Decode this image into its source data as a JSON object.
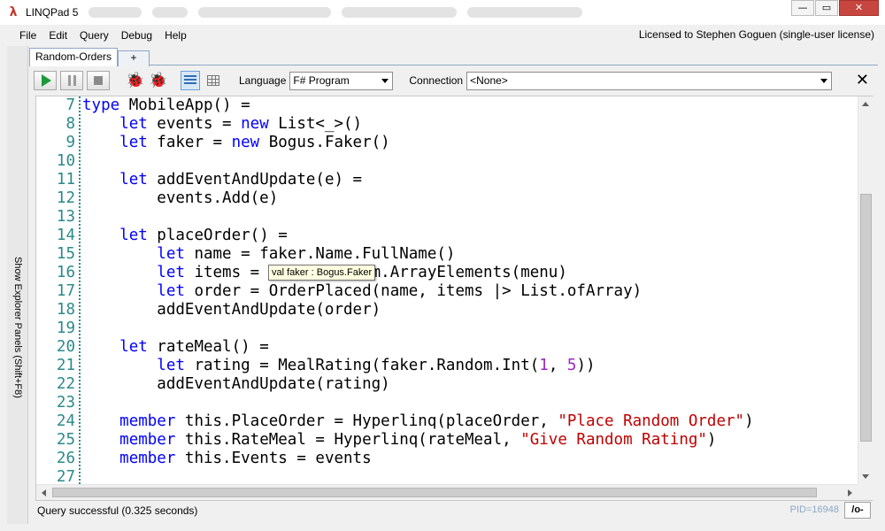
{
  "window": {
    "title": "LINQPad 5",
    "minimize_glyph": "—",
    "maximize_glyph": "▭",
    "close_glyph": "✕"
  },
  "menu": {
    "items": [
      {
        "label": "File"
      },
      {
        "label": "Edit"
      },
      {
        "label": "Query"
      },
      {
        "label": "Debug"
      },
      {
        "label": "Help"
      }
    ],
    "license": "Licensed to Stephen Goguen (single-user license)"
  },
  "side": {
    "explorer_label": "Show Explorer Panels  (Shift+F8)"
  },
  "tabs": {
    "active": "Random-Orders",
    "add": "+"
  },
  "toolbar": {
    "language_label": "Language",
    "language_value": "F# Program",
    "connection_label": "Connection",
    "connection_value": "<None>",
    "close_glyph": "✕"
  },
  "editor": {
    "lines": [
      {
        "n": "7",
        "tokens": [
          {
            "t": "type",
            "k": "kw"
          },
          {
            "t": " MobileApp() ="
          }
        ]
      },
      {
        "n": "8",
        "tokens": [
          {
            "t": "    "
          },
          {
            "t": "let",
            "k": "kw"
          },
          {
            "t": " events = "
          },
          {
            "t": "new",
            "k": "kw"
          },
          {
            "t": " List<_>()"
          }
        ]
      },
      {
        "n": "9",
        "tokens": [
          {
            "t": "    "
          },
          {
            "t": "let",
            "k": "kw"
          },
          {
            "t": " faker = "
          },
          {
            "t": "new",
            "k": "kw"
          },
          {
            "t": " Bogus.Faker()"
          }
        ]
      },
      {
        "n": "10",
        "tokens": []
      },
      {
        "n": "11",
        "tokens": [
          {
            "t": "    "
          },
          {
            "t": "let",
            "k": "kw"
          },
          {
            "t": " addEventAndUpdate(e) ="
          }
        ]
      },
      {
        "n": "12",
        "tokens": [
          {
            "t": "        events.Add(e)"
          }
        ]
      },
      {
        "n": "13",
        "tokens": []
      },
      {
        "n": "14",
        "tokens": [
          {
            "t": "    "
          },
          {
            "t": "let",
            "k": "kw"
          },
          {
            "t": " placeOrder() ="
          }
        ]
      },
      {
        "n": "15",
        "tokens": [
          {
            "t": "        "
          },
          {
            "t": "let",
            "k": "kw"
          },
          {
            "t": " name = faker.Name.FullName()"
          }
        ]
      },
      {
        "n": "16",
        "tokens": [
          {
            "t": "        "
          },
          {
            "t": "let",
            "k": "kw"
          },
          {
            "t": " items = faker.Random.ArrayElements(menu)"
          }
        ]
      },
      {
        "n": "17",
        "tokens": [
          {
            "t": "        "
          },
          {
            "t": "let",
            "k": "kw"
          },
          {
            "t": " order = OrderPlaced(name, items |> List.ofArray)"
          }
        ]
      },
      {
        "n": "18",
        "tokens": [
          {
            "t": "        addEventAndUpdate(order)"
          }
        ]
      },
      {
        "n": "19",
        "tokens": []
      },
      {
        "n": "20",
        "tokens": [
          {
            "t": "    "
          },
          {
            "t": "let",
            "k": "kw"
          },
          {
            "t": " rateMeal() ="
          }
        ]
      },
      {
        "n": "21",
        "tokens": [
          {
            "t": "        "
          },
          {
            "t": "let",
            "k": "kw"
          },
          {
            "t": " rating = MealRating(faker.Random.Int("
          },
          {
            "t": "1",
            "k": "num"
          },
          {
            "t": ", "
          },
          {
            "t": "5",
            "k": "num"
          },
          {
            "t": "))"
          }
        ]
      },
      {
        "n": "22",
        "tokens": [
          {
            "t": "        addEventAndUpdate(rating)"
          }
        ]
      },
      {
        "n": "23",
        "tokens": []
      },
      {
        "n": "24",
        "tokens": [
          {
            "t": "    "
          },
          {
            "t": "member",
            "k": "kw"
          },
          {
            "t": " this.PlaceOrder = Hyperlinq(placeOrder, "
          },
          {
            "t": "\"Place Random Order\"",
            "k": "str"
          },
          {
            "t": ")"
          }
        ]
      },
      {
        "n": "25",
        "tokens": [
          {
            "t": "    "
          },
          {
            "t": "member",
            "k": "kw"
          },
          {
            "t": " this.RateMeal = Hyperlinq(rateMeal, "
          },
          {
            "t": "\"Give Random Rating\"",
            "k": "str"
          },
          {
            "t": ")"
          }
        ]
      },
      {
        "n": "26",
        "tokens": [
          {
            "t": "    "
          },
          {
            "t": "member",
            "k": "kw"
          },
          {
            "t": " this.Events = events"
          }
        ]
      },
      {
        "n": "27",
        "tokens": []
      }
    ],
    "tooltip": "val faker : Bogus.Faker"
  },
  "status": {
    "message": "Query successful  (0.325 seconds)",
    "pid": "PID=16948",
    "results_toggle": "/o-"
  },
  "colors": {
    "keyword": "#0000ff",
    "string": "#c00000",
    "number": "#9b28c8",
    "line_number": "#2b8a8a"
  }
}
